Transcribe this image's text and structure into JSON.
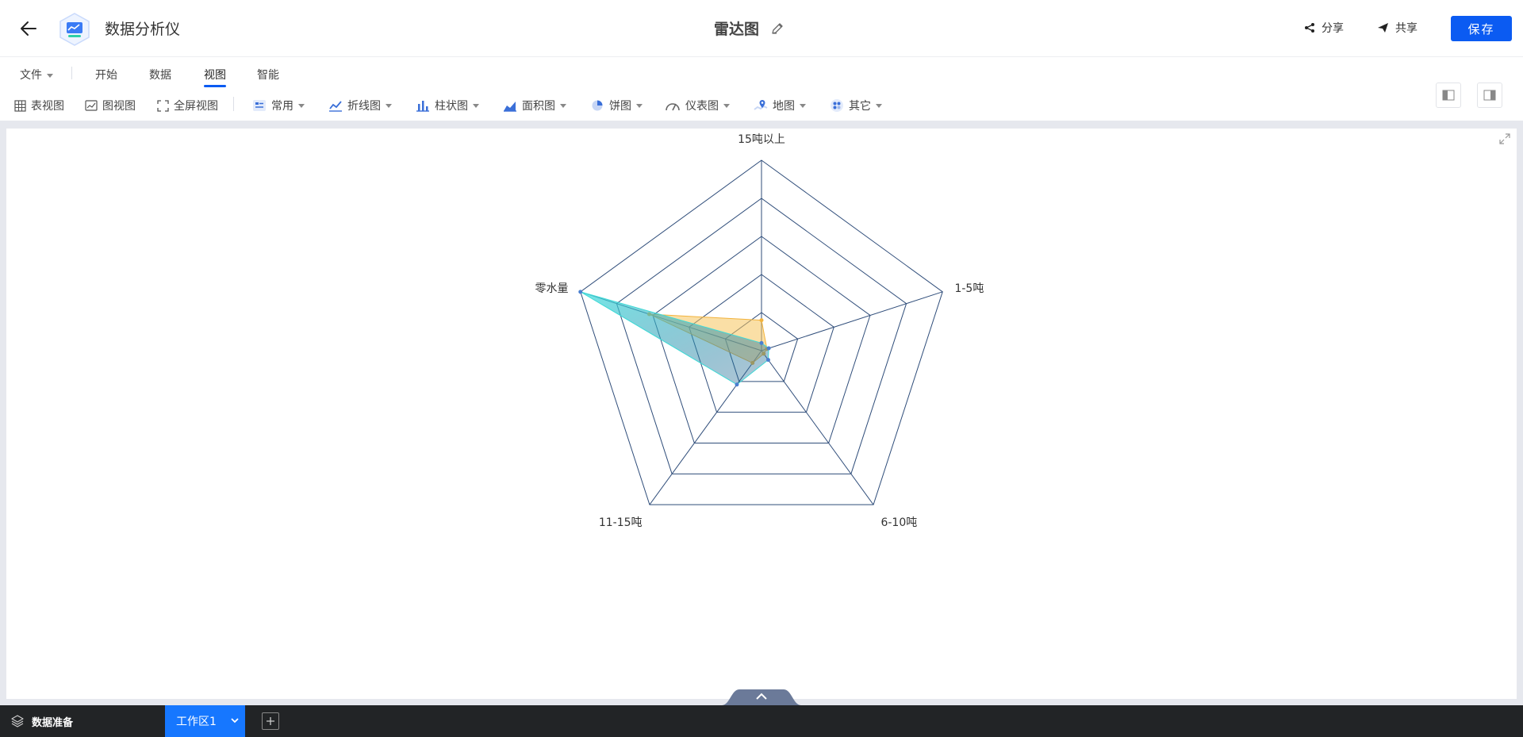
{
  "app": {
    "name": "数据分析仪",
    "logo_icon": "chart-monitor-icon"
  },
  "document": {
    "title": "雷达图"
  },
  "header": {
    "share_label": "分享",
    "public_label": "共享",
    "save_label": "保存"
  },
  "menu": {
    "file": "文件",
    "items": [
      "开始",
      "数据",
      "视图",
      "智能"
    ],
    "active": "视图"
  },
  "toolbar": {
    "table_view": "表视图",
    "chart_view": "图视图",
    "fullscreen_view": "全屏视图",
    "dropdowns": [
      "常用",
      "折线图",
      "柱状图",
      "面积图",
      "饼图",
      "仪表图",
      "地图",
      "其它"
    ]
  },
  "bottom": {
    "data_prep": "数据准备",
    "workspace_tab": "工作区1"
  },
  "colors": {
    "accent": "#0b5bf2",
    "series_orange": "#f2b33d",
    "series_cyan": "#3fd9d6",
    "grid": "#2f4d7a"
  },
  "chart_data": {
    "type": "radar",
    "indicators": [
      "15吨以上",
      "1-5吨",
      "6-10吨",
      "11-15吨",
      "零水量"
    ],
    "max": 100,
    "split_number": 5,
    "series": [
      {
        "values": [
          16,
          3,
          2,
          8,
          62
        ]
      },
      {
        "values": [
          4,
          4,
          6,
          22,
          100
        ]
      }
    ]
  }
}
